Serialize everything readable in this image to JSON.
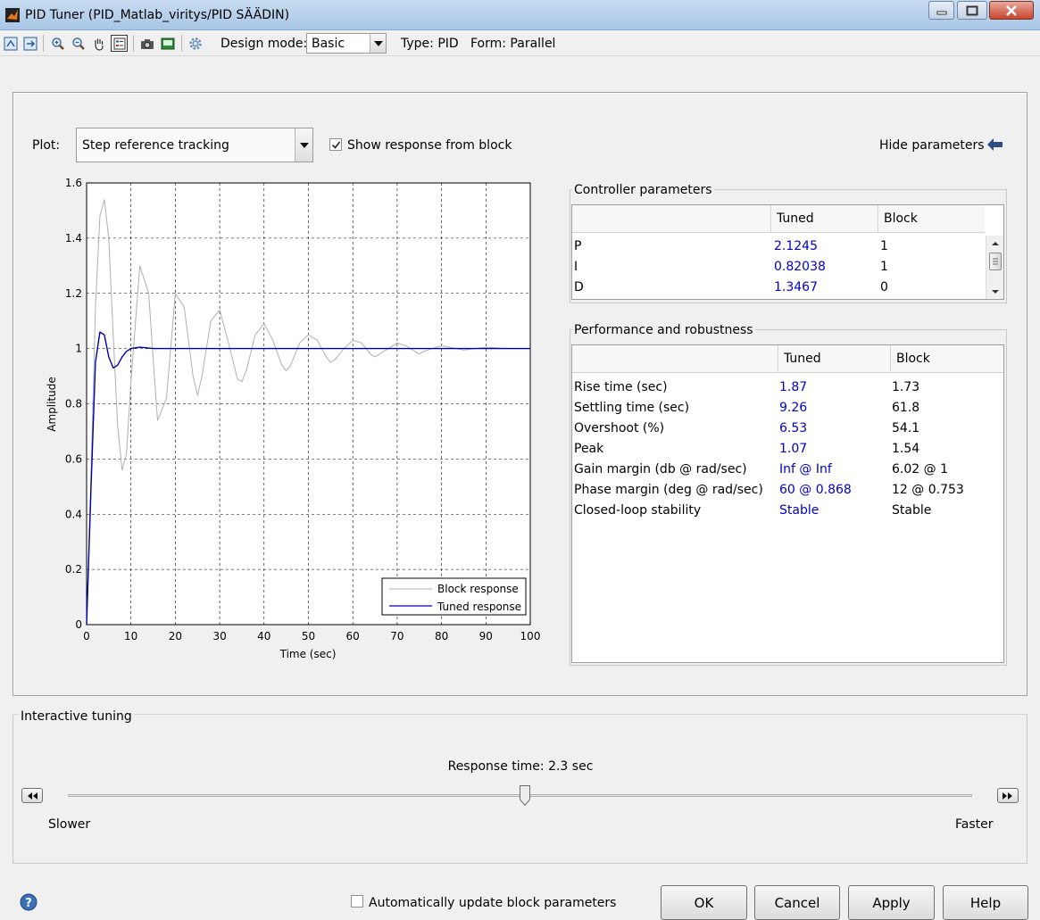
{
  "window": {
    "title": "PID Tuner (PID_Matlab_viritys/PID SÄÄDIN)"
  },
  "toolbar": {
    "design_mode_label": "Design mode:",
    "design_mode_value": "Basic",
    "type_label": "Type: PID",
    "form_label": "Form: Parallel",
    "icons": [
      "import-plant-icon",
      "export-icon",
      "zoom-in-icon",
      "zoom-out-icon",
      "pan-hand-icon",
      "data-cursor-icon",
      "camera-icon",
      "display-icon",
      "gear-icon"
    ]
  },
  "plot_controls": {
    "plot_label": "Plot:",
    "plot_value": "Step reference tracking",
    "show_response_label": "Show response from block",
    "show_response_checked": true,
    "hide_parameters_label": "Hide parameters"
  },
  "chart_data": {
    "type": "line",
    "xlabel": "Time (sec)",
    "ylabel": "Amplitude",
    "xlim": [
      0,
      100
    ],
    "ylim": [
      0,
      1.6
    ],
    "xticks": [
      0,
      10,
      20,
      30,
      40,
      50,
      60,
      70,
      80,
      90,
      100
    ],
    "yticks": [
      0,
      0.2,
      0.4,
      0.6,
      0.8,
      1,
      1.2,
      1.4,
      1.6
    ],
    "x_tick_labels": [
      "0",
      "10",
      "20",
      "30",
      "40",
      "50",
      "60",
      "70",
      "80",
      "90",
      "100"
    ],
    "y_tick_labels": [
      "0",
      "0.2",
      "0.4",
      "0.6",
      "0.8",
      "1",
      "1.2",
      "1.4",
      "1.6"
    ],
    "grid": true,
    "legend_position": "bottom-right",
    "series": [
      {
        "name": "Block response",
        "color": "#b0b0b0",
        "x": [
          0,
          1,
          2,
          3,
          4,
          5,
          6,
          7,
          8,
          9,
          10,
          12,
          14,
          15,
          16,
          18,
          20,
          22,
          24,
          25,
          26,
          28,
          30,
          32,
          34,
          35,
          36,
          38,
          40,
          42,
          44,
          45,
          46,
          48,
          50,
          52,
          54,
          55,
          56,
          58,
          60,
          62,
          64,
          65,
          66,
          68,
          70,
          72,
          74,
          75,
          76,
          80,
          85,
          90,
          95,
          100
        ],
        "y": [
          0,
          0.55,
          1.15,
          1.48,
          1.54,
          1.4,
          1.05,
          0.72,
          0.56,
          0.62,
          0.88,
          1.3,
          1.2,
          0.96,
          0.74,
          0.82,
          1.2,
          1.15,
          0.9,
          0.83,
          0.9,
          1.1,
          1.14,
          1.02,
          0.89,
          0.88,
          0.92,
          1.05,
          1.09,
          1.03,
          0.94,
          0.92,
          0.94,
          1.02,
          1.05,
          1.03,
          0.97,
          0.95,
          0.96,
          1.0,
          1.03,
          1.02,
          0.98,
          0.97,
          0.98,
          1.0,
          1.02,
          1.01,
          0.99,
          0.98,
          0.99,
          1.01,
          0.995,
          1.005,
          1.0,
          1.0
        ]
      },
      {
        "name": "Tuned response",
        "color": "#0000aa",
        "x": [
          0,
          1,
          2,
          3,
          4,
          5,
          6,
          7,
          8,
          9,
          10,
          12,
          15,
          20,
          30,
          40,
          50,
          60,
          70,
          80,
          90,
          100
        ],
        "y": [
          0,
          0.5,
          0.95,
          1.06,
          1.05,
          0.97,
          0.93,
          0.94,
          0.97,
          0.99,
          1.0,
          1.005,
          1.0,
          1.0,
          1.0,
          1.0,
          1.0,
          1.0,
          1.0,
          1.0,
          1.0,
          1.0
        ]
      }
    ]
  },
  "controller_parameters": {
    "title": "Controller parameters",
    "columns": [
      "Tuned",
      "Block"
    ],
    "rows": [
      {
        "name": "P",
        "tuned": "2.1245",
        "block": "1"
      },
      {
        "name": "I",
        "tuned": "0.82038",
        "block": "1"
      },
      {
        "name": "D",
        "tuned": "1.3467",
        "block": "0"
      }
    ]
  },
  "performance": {
    "title": "Performance and robustness",
    "columns": [
      "Tuned",
      "Block"
    ],
    "rows": [
      {
        "name": "Rise time (sec)",
        "tuned": "1.87",
        "block": "1.73"
      },
      {
        "name": "Settling time (sec)",
        "tuned": "9.26",
        "block": "61.8"
      },
      {
        "name": "Overshoot (%)",
        "tuned": "6.53",
        "block": "54.1"
      },
      {
        "name": "Peak",
        "tuned": "1.07",
        "block": "1.54"
      },
      {
        "name": "Gain margin (db @ rad/sec)",
        "tuned": "Inf @ Inf",
        "block": "6.02 @ 1"
      },
      {
        "name": "Phase margin (deg @ rad/sec)",
        "tuned": "60 @ 0.868",
        "block": "12 @ 0.753"
      },
      {
        "name": "Closed-loop stability",
        "tuned": "Stable",
        "block": "Stable"
      }
    ]
  },
  "tuning": {
    "title": "Interactive tuning",
    "response_time_label": "Response time: 2.3 sec",
    "slower_label": "Slower",
    "faster_label": "Faster",
    "slider_fraction": 0.505
  },
  "footer": {
    "auto_update_label": "Automatically update block parameters",
    "auto_update_checked": false,
    "ok_label": "OK",
    "cancel_label": "Cancel",
    "apply_label": "Apply",
    "help_label": "Help"
  }
}
